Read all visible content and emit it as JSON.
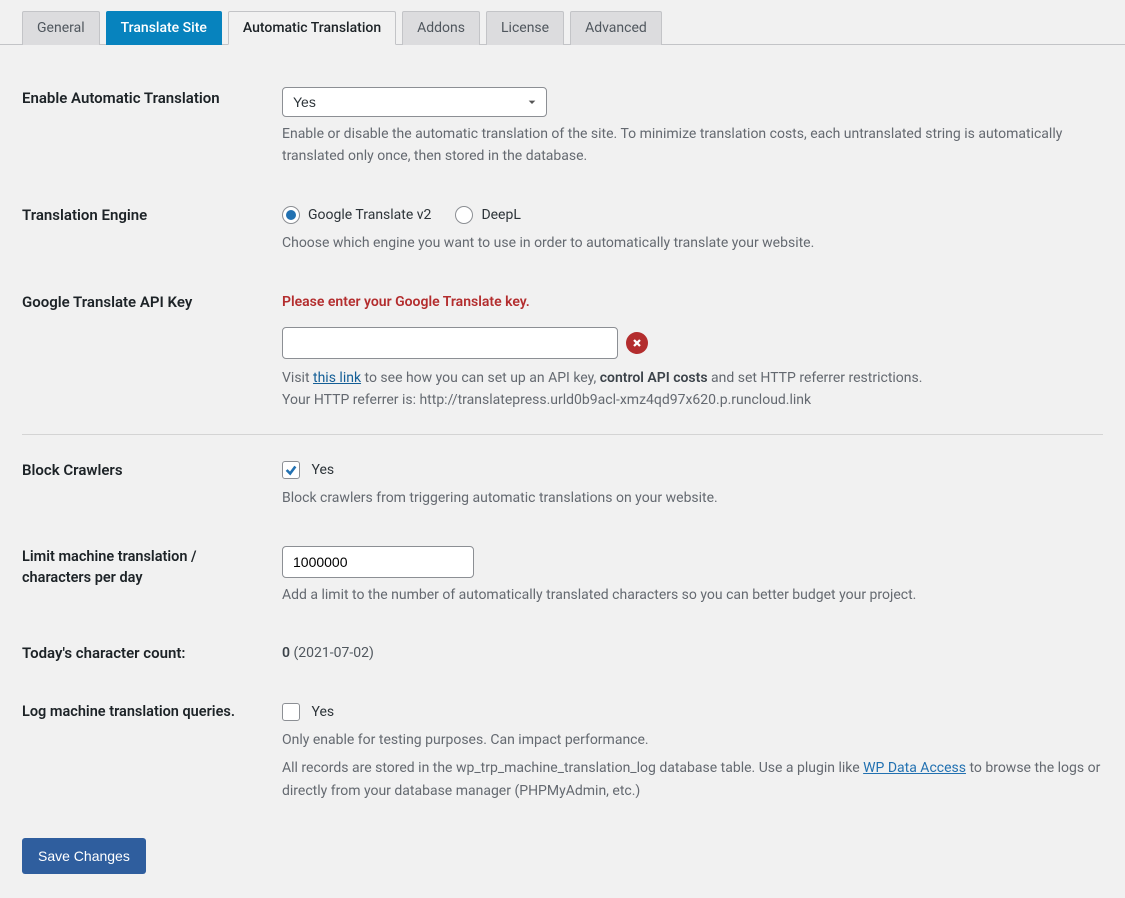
{
  "tabs": {
    "general": "General",
    "translate_site": "Translate Site",
    "automatic_translation": "Automatic Translation",
    "addons": "Addons",
    "license": "License",
    "advanced": "Advanced"
  },
  "enable": {
    "label": "Enable Automatic Translation",
    "value": "Yes",
    "help": "Enable or disable the automatic translation of the site. To minimize translation costs, each untranslated string is automatically translated only once, then stored in the database."
  },
  "engine": {
    "label": "Translation Engine",
    "opt_google": "Google Translate v2",
    "opt_deepl": "DeepL",
    "help": "Choose which engine you want to use in order to automatically translate your website."
  },
  "apikey": {
    "label": "Google Translate API Key",
    "error": "Please enter your Google Translate key.",
    "help_prefix": "Visit ",
    "help_link": "this link",
    "help_mid": " to see how you can set up an API key, ",
    "help_bold": "control API costs",
    "help_suffix": " and set HTTP referrer restrictions.",
    "referrer_label": "Your HTTP referrer is: ",
    "referrer_value": "http://translatepress.urld0b9acl-xmz4qd97x620.p.runcloud.link"
  },
  "block": {
    "label": "Block Crawlers",
    "chk_label": "Yes",
    "help": "Block crawlers from triggering automatic translations on your website."
  },
  "limit": {
    "label": "Limit machine translation / characters per day",
    "value": "1000000",
    "help": "Add a limit to the number of automatically translated characters so you can better budget your project."
  },
  "today": {
    "label": "Today's character count:",
    "count": "0",
    "date": " (2021-07-02)"
  },
  "log": {
    "label": "Log machine translation queries.",
    "chk_label": "Yes",
    "help1": "Only enable for testing purposes. Can impact performance.",
    "help2_pre": "All records are stored in the wp_trp_machine_translation_log database table. Use a plugin like ",
    "help2_link": "WP Data Access",
    "help2_post": " to browse the logs or directly from your database manager (PHPMyAdmin, etc.)"
  },
  "save_label": "Save Changes"
}
